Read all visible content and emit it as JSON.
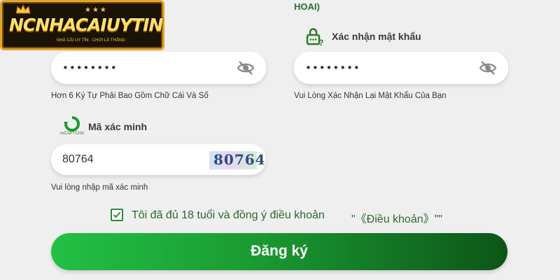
{
  "logo": {
    "text": "NCNHACAIUYTIN",
    "tagline": "NHÀ CÁI UY TÍN · CHƠI LÀ THẮNG",
    "stars": "★★★"
  },
  "top_fragment": "HOAI)",
  "password_field": {
    "value": "••••••••",
    "hint": "Hơn 6 Ký Tự Phải Bao Gồm Chữ Cái Và Số"
  },
  "confirm_password": {
    "label": "Xác nhận mật khẩu",
    "value": "••••••••",
    "hint": "Vui Lòng Xác Nhận Lại Mật Khẩu Của Bạn"
  },
  "captcha": {
    "label": "Mã xác minh",
    "recaptcha_text": "reCAPTCHA",
    "value": "80764",
    "image_text": "80764",
    "hint": "Vui lòng nhập mã xác minh"
  },
  "agreement": {
    "checked": true,
    "text": "Tôi đã đủ 18 tuổi và đồng ý điều khoản",
    "terms_link": "\"《Điều khoản》\"\""
  },
  "register_button": {
    "label": "Đăng ký"
  },
  "colors": {
    "accent_green": "#1a9a32",
    "dark_green": "#0d5518",
    "logo_gold": "#f4c542"
  }
}
